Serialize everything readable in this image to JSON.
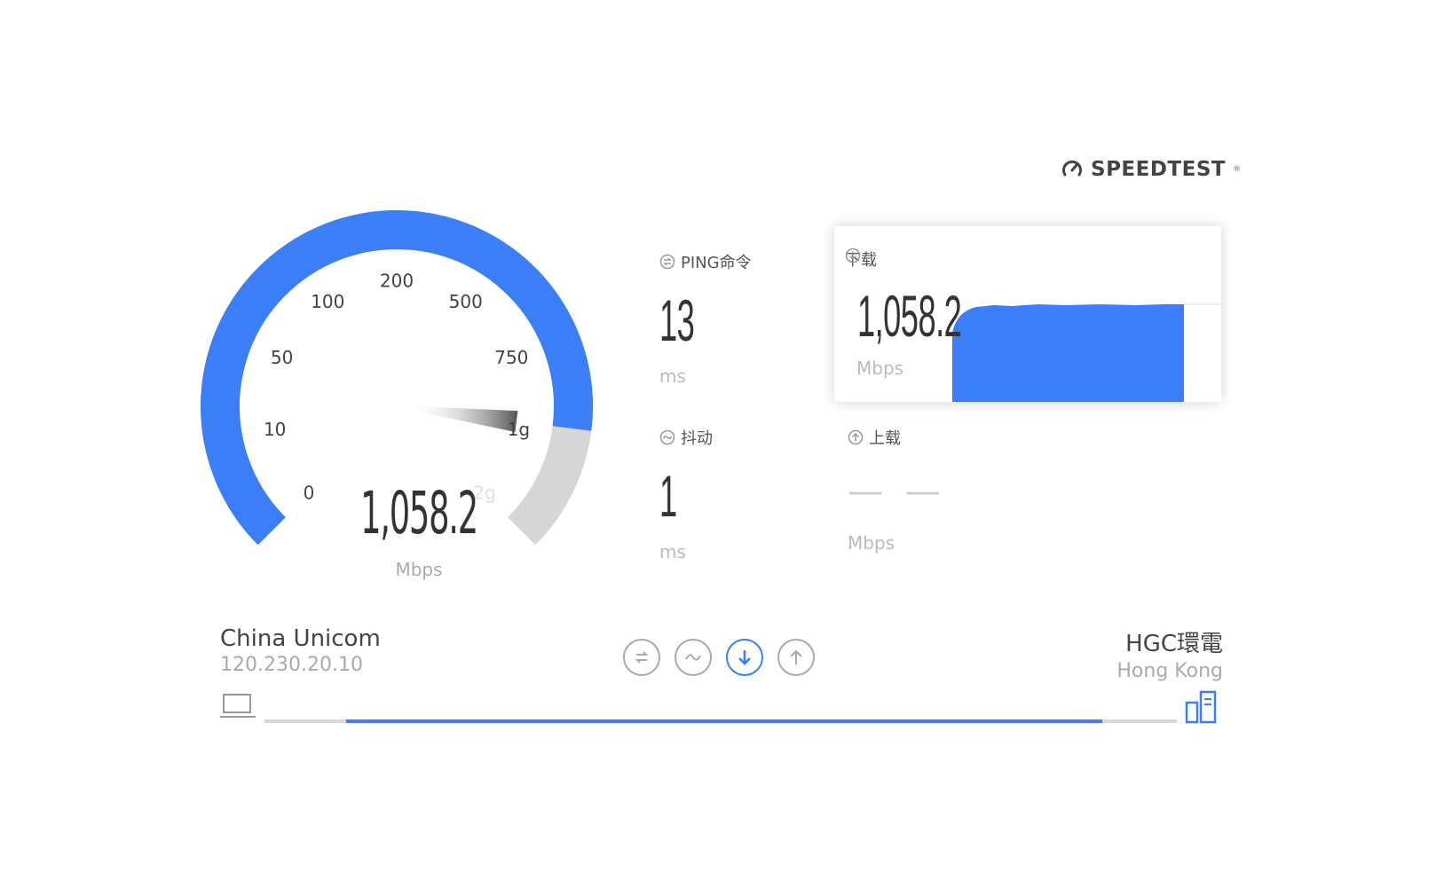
{
  "brand": {
    "name": "SPEEDTEST",
    "mark": "®"
  },
  "gauge": {
    "value": "1,058.2",
    "unit": "Mbps",
    "ticks": [
      "0",
      "10",
      "50",
      "100",
      "200",
      "500",
      "750",
      "1g",
      "2g"
    ],
    "fill_fraction": 0.86,
    "colors": {
      "fill": "#3b7ef7",
      "track": "#d6d6d6"
    }
  },
  "ping": {
    "label": "PING命令",
    "value": "13",
    "unit": "ms"
  },
  "jitter": {
    "label": "抖动",
    "value": "1",
    "unit": "ms"
  },
  "download": {
    "label": "下载",
    "value": "1,058.2",
    "unit": "Mbps"
  },
  "upload": {
    "label": "上载",
    "value": "— —",
    "unit": "Mbps"
  },
  "isp": {
    "name": "China Unicom",
    "ip": "120.230.20.10"
  },
  "server": {
    "name": "HGC環電",
    "location": "Hong Kong"
  },
  "stages": [
    "ping",
    "jitter",
    "download",
    "upload"
  ],
  "active_stage": "download",
  "progress": {
    "fraction": 0.91,
    "color": "#3b7ef7"
  }
}
